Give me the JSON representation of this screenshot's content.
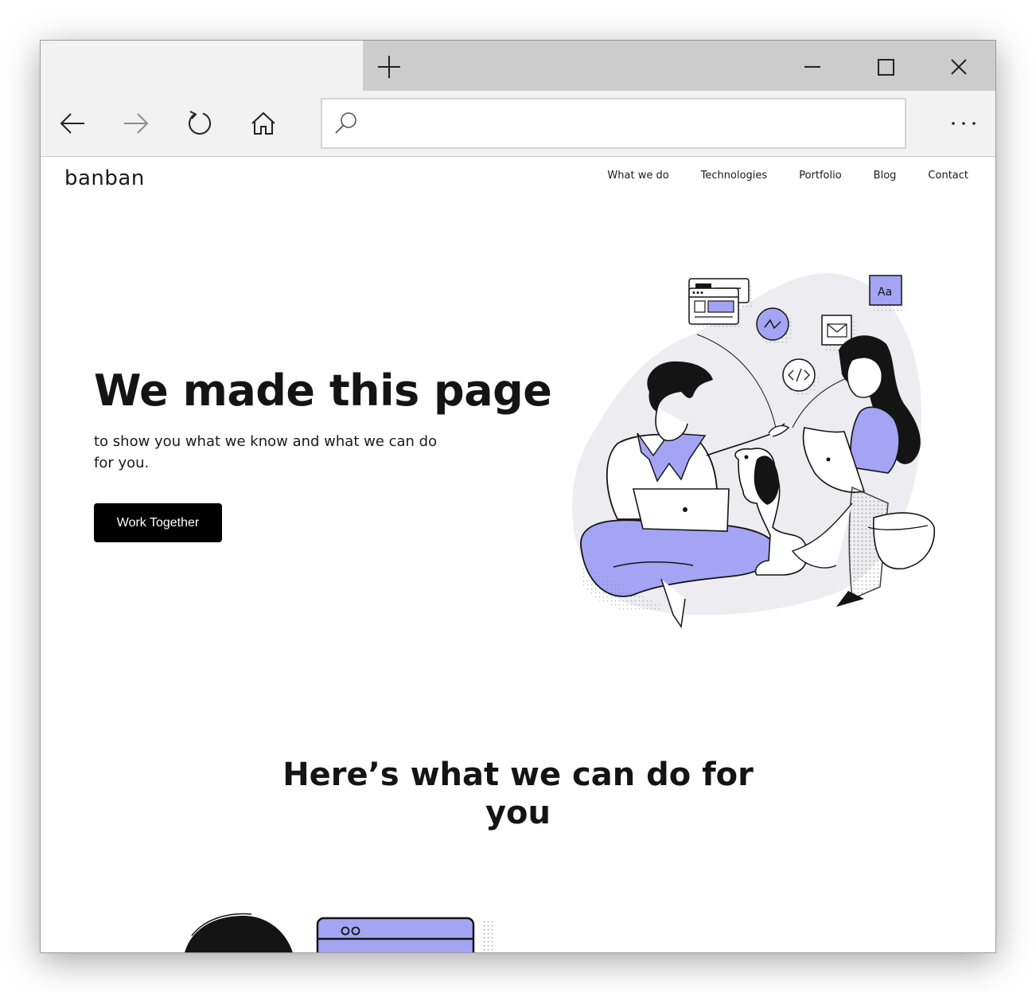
{
  "browser": {
    "tab_title": "",
    "address_value": "",
    "icons": [
      "new-tab-icon",
      "minimize-icon",
      "maximize-icon",
      "close-icon",
      "back-arrow-icon",
      "forward-arrow-icon",
      "reload-icon",
      "home-icon",
      "search-icon",
      "more-icon"
    ]
  },
  "site": {
    "logo": "banban",
    "nav": [
      "What we do",
      "Technologies",
      "Portfolio",
      "Blog",
      "Contact"
    ],
    "hero": {
      "title": "We made this page",
      "subtitle": "to show you what we know and what we can do for you.",
      "cta": "Work Together"
    },
    "section": {
      "title": "Here’s what we can do for you"
    },
    "illustration_icons": {
      "font_card": "Aa"
    }
  },
  "colors": {
    "accent": "#a4a4f4",
    "blob": "#ececf1",
    "ink": "#141414",
    "button": "#000000"
  }
}
